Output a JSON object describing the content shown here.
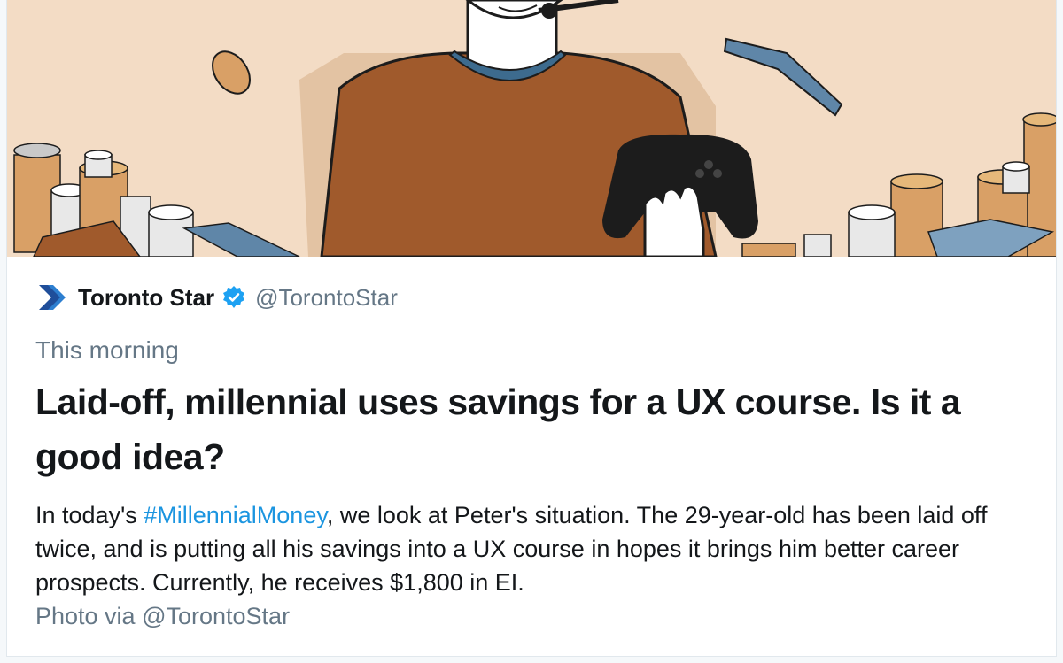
{
  "tweet": {
    "author_name": "Toronto Star",
    "handle": "@TorontoStar",
    "timestamp": "This morning",
    "headline": "Laid-off, millennial uses savings for a UX course. Is it a good idea?",
    "body_before": "In today's ",
    "hashtag": "#MillennialMoney",
    "body_after": ", we look at Peter's situation. The 29-year-old has been laid off twice, and is putting all his savings into a UX course in hopes it brings him better career prospects. Currently, he receives $1,800 in EI.",
    "photo_credit": "Photo via @TorontoStar"
  },
  "icons": {
    "logo": "toronto-star-logo-icon",
    "verified": "verified-badge-icon"
  },
  "colors": {
    "hashtag": "#1b95e0",
    "secondary_text": "#657786",
    "primary_text": "#14171a",
    "verified": "#1da1f2",
    "hero_background": "#f3dcc5"
  }
}
